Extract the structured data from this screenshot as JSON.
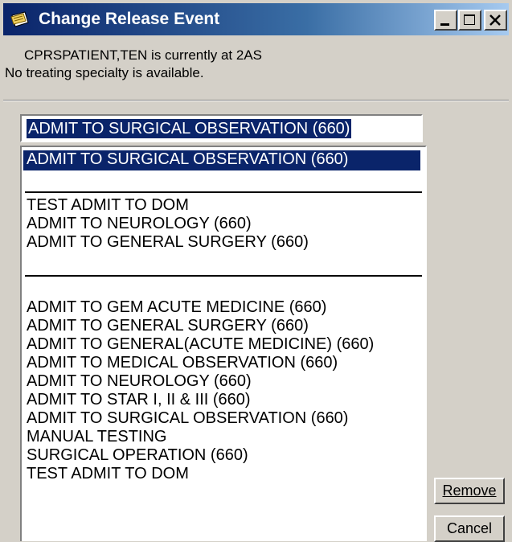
{
  "window": {
    "title": "Change Release Event",
    "icon": "notepad-icon"
  },
  "info": {
    "line1": "CPRSPATIENT,TEN is currently at 2AS",
    "line2": "No treating specialty is available."
  },
  "combo": {
    "value": "ADMIT TO SURGICAL OBSERVATION (660)"
  },
  "list": {
    "selected": "ADMIT TO SURGICAL OBSERVATION (660)",
    "group1": [
      "TEST ADMIT TO DOM",
      "ADMIT TO NEUROLOGY (660)",
      "ADMIT TO GENERAL SURGERY (660)"
    ],
    "group2": [
      "ADMIT TO GEM ACUTE MEDICINE (660)",
      "ADMIT TO GENERAL SURGERY (660)",
      "ADMIT TO GENERAL(ACUTE MEDICINE) (660)",
      "ADMIT TO MEDICAL OBSERVATION (660)",
      "ADMIT TO NEUROLOGY (660)",
      "ADMIT TO STAR I, II & III (660)",
      "ADMIT TO SURGICAL OBSERVATION (660)",
      "MANUAL TESTING",
      "SURGICAL OPERATION (660)",
      "TEST ADMIT TO DOM"
    ]
  },
  "buttons": {
    "remove": "Remove",
    "cancel": "Cancel"
  }
}
